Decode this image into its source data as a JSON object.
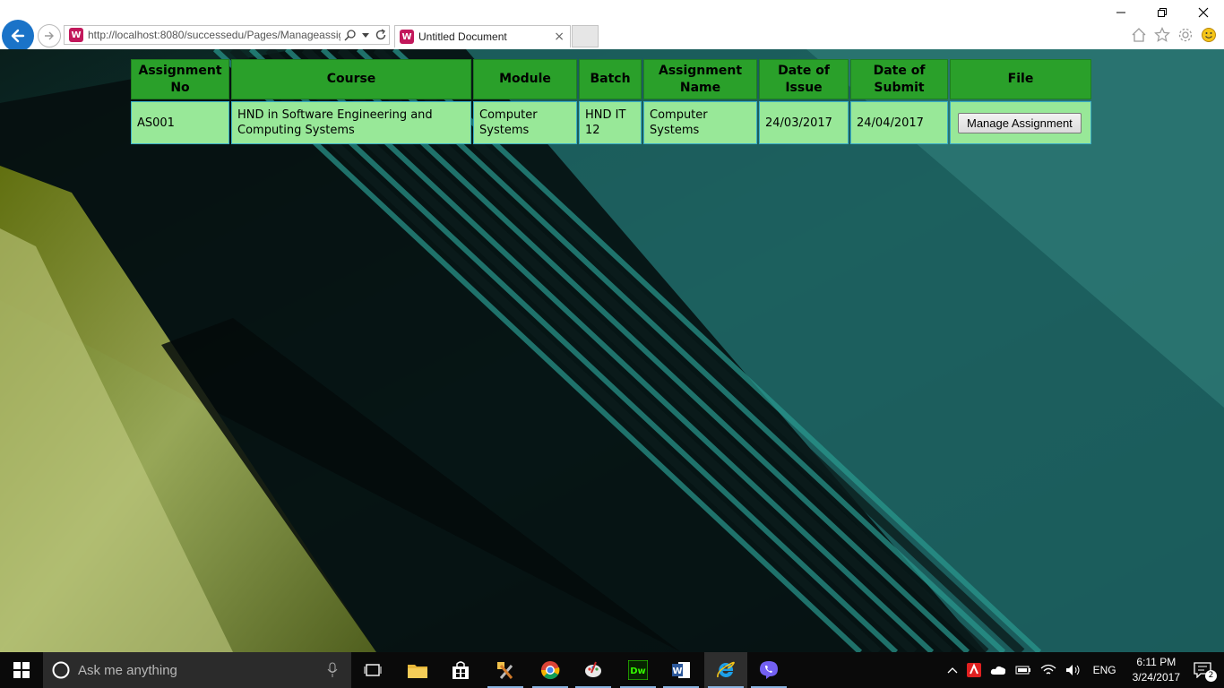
{
  "browser": {
    "url": "http://localhost:8080/successedu/Pages/Manageassig",
    "tab_title": "Untitled Document",
    "tab_close": "×"
  },
  "table": {
    "headers": [
      "Assignment No",
      "Course",
      "Module",
      "Batch",
      "Assignment Name",
      "Date of Issue",
      "Date of Submit",
      "File"
    ],
    "rows": [
      {
        "assignment_no": "AS001",
        "course": "HND in Software Engineering and Computing Systems",
        "module": "Computer Systems",
        "batch": "HND IT 12",
        "assignment_name": "Computer Systems",
        "date_of_issue": "24/03/2017",
        "date_of_submit": "24/04/2017",
        "file_button": "Manage Assignment"
      }
    ]
  },
  "taskbar": {
    "search_placeholder": "Ask me anything",
    "language": "ENG",
    "time": "6:11 PM",
    "date": "3/24/2017",
    "notification_count": "2",
    "apps": [
      "file-explorer",
      "store",
      "tools",
      "chrome",
      "paint",
      "dreamweaver",
      "word",
      "internet-explorer",
      "viber"
    ]
  },
  "colors": {
    "header_green": "#2aa02a",
    "cell_green": "#98e898",
    "ie_blue": "#1a73c8"
  }
}
